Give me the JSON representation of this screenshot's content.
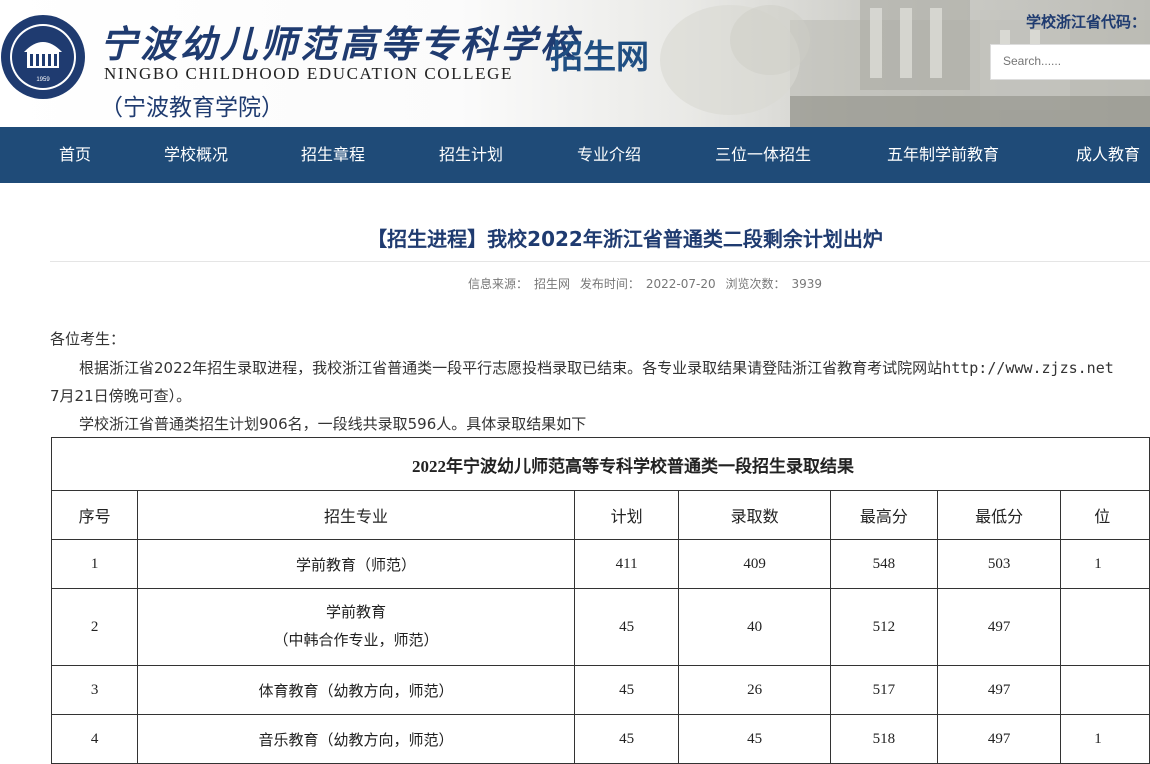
{
  "header": {
    "school_name_cn": "宁波幼儿师范高等专科学校",
    "school_name_en": "NINGBO CHILDHOOD EDUCATION COLLEGE",
    "school_alt_name": "（宁波教育学院）",
    "site_name": "招生网",
    "code_label": "学校浙江省代码：",
    "search_placeholder": "Search......",
    "logo_year": "1959",
    "accent_color": "#f0a020"
  },
  "nav": {
    "items": [
      {
        "label": "首页"
      },
      {
        "label": "学校概况"
      },
      {
        "label": "招生章程"
      },
      {
        "label": "招生计划"
      },
      {
        "label": "专业介绍"
      },
      {
        "label": "三位一体招生"
      },
      {
        "label": "五年制学前教育"
      },
      {
        "label": "成人教育"
      }
    ],
    "bg_color": "#1f4b78"
  },
  "article": {
    "title": "【招生进程】我校2022年浙江省普通类二段剩余计划出炉",
    "meta": {
      "source_label": "信息来源：",
      "source": "招生网",
      "time_label": "发布时间：",
      "time": "2022-07-20",
      "views_label": "浏览次数：",
      "views": "3939"
    },
    "greeting": "各位考生：",
    "p1_text": "根据浙江省2022年招生录取进程，我校浙江省普通类一段平行志愿投档录取已结束。各专业录取结果请登陆浙江省教育考试院网站",
    "p1_url": "http://www.zjzs.net",
    "p1_cont": "7月21日傍晚可查）。",
    "p2": "学校浙江省普通类招生计划906名，一段线共录取596人。具体录取结果如下"
  },
  "table": {
    "caption": "2022年宁波幼儿师范高等专科学校普通类一段招生录取结果",
    "headers": [
      "序号",
      "招生专业",
      "计划",
      "录取数",
      "最高分",
      "最低分",
      "位"
    ],
    "rows": [
      {
        "no": "1",
        "major": "学前教育（师范）",
        "major2": "",
        "plan": "411",
        "admitted": "409",
        "max": "548",
        "min": "503",
        "rank": "1"
      },
      {
        "no": "2",
        "major": "学前教育",
        "major2": "（中韩合作专业，师范）",
        "plan": "45",
        "admitted": "40",
        "max": "512",
        "min": "497",
        "rank": ""
      },
      {
        "no": "3",
        "major": "体育教育（幼教方向，师范）",
        "major2": "",
        "plan": "45",
        "admitted": "26",
        "max": "517",
        "min": "497",
        "rank": ""
      },
      {
        "no": "4",
        "major": "音乐教育（幼教方向，师范）",
        "major2": "",
        "plan": "45",
        "admitted": "45",
        "max": "518",
        "min": "497",
        "rank": "1"
      }
    ]
  }
}
